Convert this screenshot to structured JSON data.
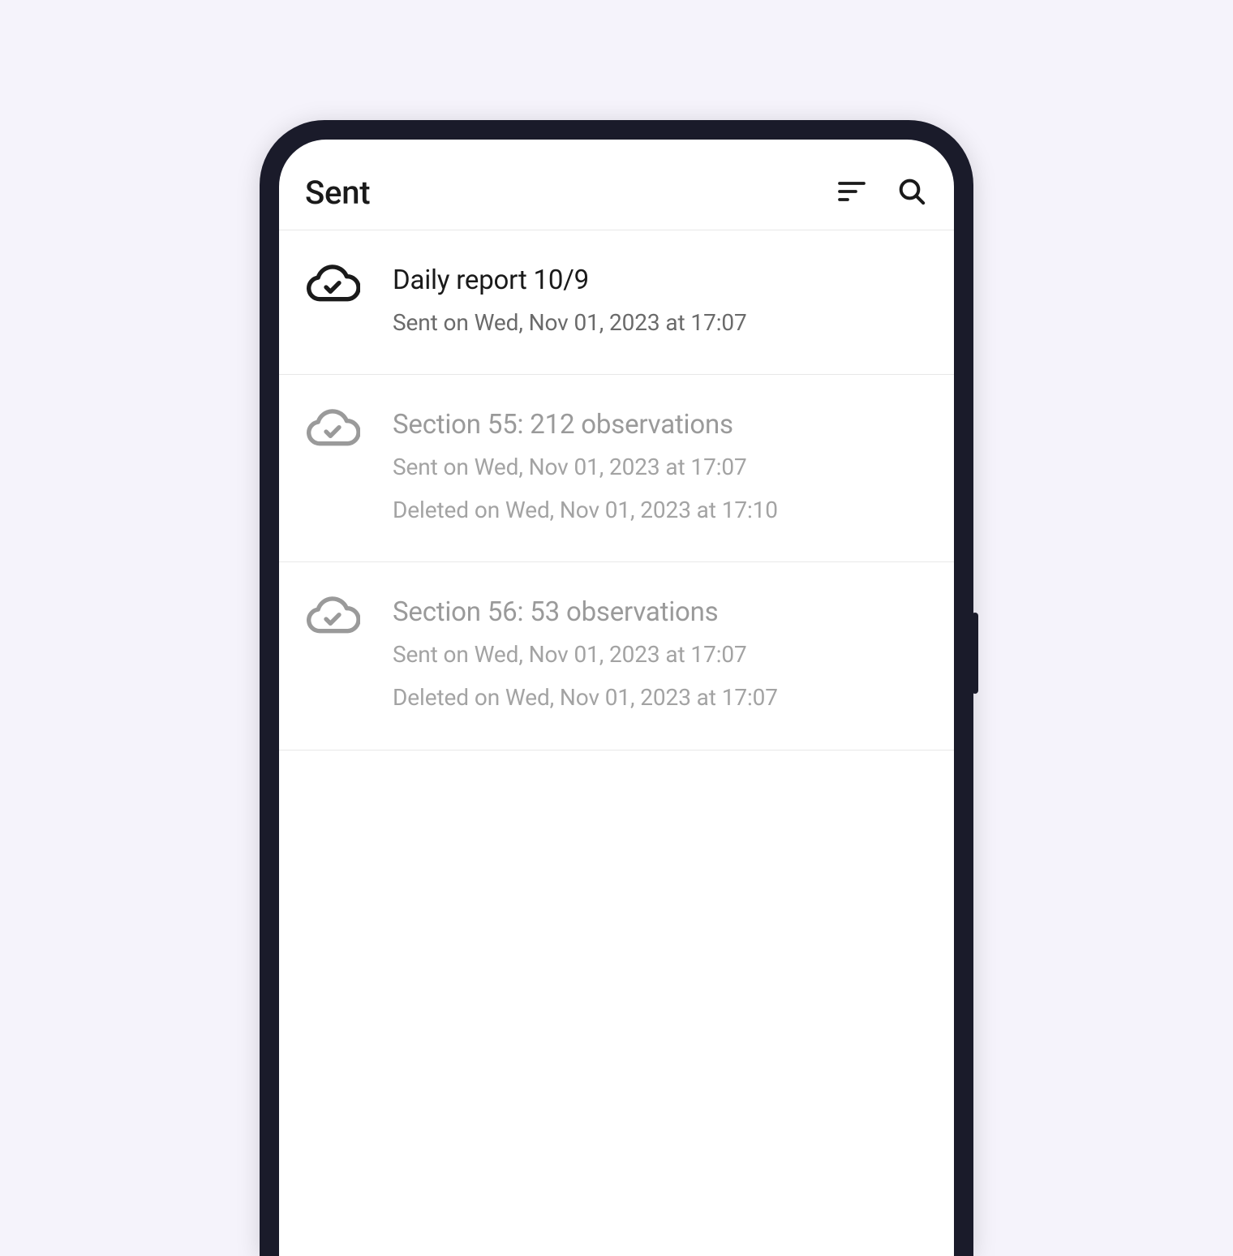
{
  "header": {
    "title": "Sent"
  },
  "icons": {
    "sort": "sort-icon",
    "search": "search-icon",
    "cloud_done": "cloud-done-icon"
  },
  "items": [
    {
      "title": "Daily report 10/9",
      "sent": "Sent on Wed, Nov 01, 2023 at 17:07",
      "deleted": "",
      "dimmed": false
    },
    {
      "title": "Section 55: 212 observations",
      "sent": "Sent on Wed, Nov 01, 2023 at 17:07",
      "deleted": "Deleted on Wed, Nov 01, 2023 at 17:10",
      "dimmed": true
    },
    {
      "title": "Section 56: 53 observations",
      "sent": "Sent on Wed, Nov 01, 2023 at 17:07",
      "deleted": "Deleted on Wed, Nov 01, 2023 at 17:07",
      "dimmed": true
    }
  ]
}
